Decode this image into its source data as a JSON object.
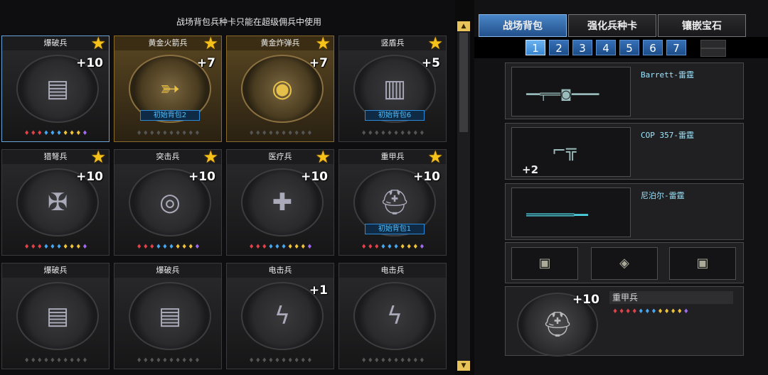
{
  "hint": "战场背包兵种卡只能在超级佣兵中使用",
  "cards": [
    {
      "title": "爆破兵",
      "level": "+10",
      "bag": "",
      "style": "normal",
      "selected": true,
      "tag": "grey",
      "gems": "♦♦♦♦♦♦♦♦♦♦",
      "icon": "pack-icon"
    },
    {
      "title": "黄金火箭兵",
      "level": "+7",
      "bag": "初始背包2",
      "style": "gold",
      "selected": false,
      "tag": "green",
      "gems": "♦♦♦♦♦♦♦♦♦♦",
      "icon": "rocket-icon"
    },
    {
      "title": "黄金炸弹兵",
      "level": "+7",
      "bag": "",
      "style": "gold",
      "selected": false,
      "tag": "green",
      "gems": "♦♦♦♦♦♦♦♦♦♦",
      "icon": "bomb-icon"
    },
    {
      "title": "竖盾兵",
      "level": "+5",
      "bag": "初始背包6",
      "style": "normal",
      "selected": false,
      "tag": "green",
      "gems": "♦♦♦♦♦♦♦♦♦♦",
      "icon": "shield-icon"
    },
    {
      "title": "猎弩兵",
      "level": "+10",
      "bag": "",
      "style": "normal",
      "selected": false,
      "tag": "grey",
      "gems": "♦♦♦♦♦♦♦♦♦♦",
      "icon": "crossbow-icon"
    },
    {
      "title": "突击兵",
      "level": "+10",
      "bag": "",
      "style": "normal",
      "selected": false,
      "tag": "grey",
      "gems": "♦♦♦♦♦♦♦♦♦♦",
      "icon": "target-icon"
    },
    {
      "title": "医疗兵",
      "level": "+10",
      "bag": "",
      "style": "normal",
      "selected": false,
      "tag": "grey",
      "gems": "♦♦♦♦♦♦♦♦♦♦",
      "icon": "medkit-icon"
    },
    {
      "title": "重甲兵",
      "level": "+10",
      "bag": "初始背包1",
      "style": "normal",
      "selected": false,
      "tag": "grey",
      "gems": "♦♦♦♦♦♦♦♦♦♦",
      "icon": "helmet-icon"
    },
    {
      "title": "爆破兵",
      "level": "",
      "bag": "",
      "style": "normal",
      "selected": false,
      "tag": "green",
      "gems": "♦♦♦♦♦♦♦♦♦♦",
      "icon": "pack-icon"
    },
    {
      "title": "爆破兵",
      "level": "",
      "bag": "",
      "style": "normal",
      "selected": false,
      "tag": "green",
      "gems": "♦♦♦♦♦♦♦♦♦♦",
      "icon": "pack-icon"
    },
    {
      "title": "电击兵",
      "level": "+1",
      "bag": "",
      "style": "normal",
      "selected": false,
      "tag": "green",
      "gems": "♦♦♦♦♦♦♦♦♦♦",
      "icon": "lightning-icon"
    },
    {
      "title": "电击兵",
      "level": "",
      "bag": "",
      "style": "normal",
      "selected": false,
      "tag": "green",
      "gems": "♦♦♦♦♦♦♦♦♦♦",
      "icon": "lightning-icon"
    }
  ],
  "tabs": [
    {
      "label": "战场背包",
      "active": true
    },
    {
      "label": "强化兵种卡",
      "active": false
    },
    {
      "label": "镶嵌宝石",
      "active": false
    }
  ],
  "pages": [
    "1",
    "2",
    "3",
    "4",
    "5",
    "6",
    "7"
  ],
  "active_page": "1",
  "weapons": [
    {
      "name": "Barrett-雷霆",
      "ammo": "",
      "icon": "sniper-rifle-icon"
    },
    {
      "name": "COP 357-雷霆",
      "ammo": "+2",
      "icon": "pistol-icon"
    },
    {
      "name": "尼泊尔-雷霆",
      "ammo": "",
      "icon": "knife-icon"
    }
  ],
  "grenades": [
    "grenade-icon",
    "grenade-icon",
    "grenade-icon"
  ],
  "soldier": {
    "name": "重甲兵",
    "level": "+10",
    "gems": "♦♦♦♦♦♦♦♦♦♦♦♦♦♦"
  },
  "colors": {
    "gold_star": "#f6c21a",
    "tab_active": "#3a78bd",
    "badge_blue": "#4fc0ff"
  }
}
